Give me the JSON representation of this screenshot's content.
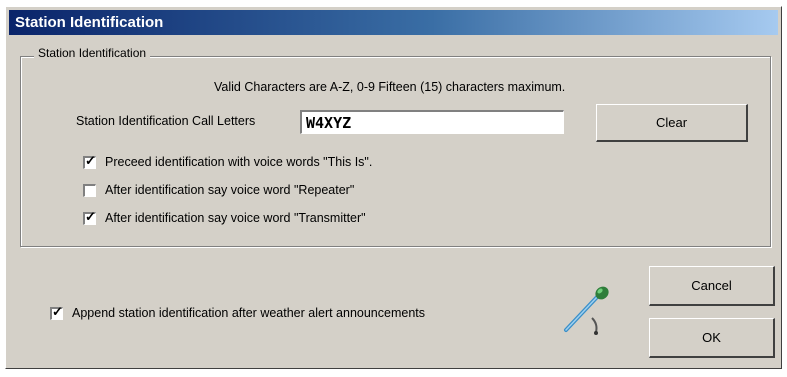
{
  "window": {
    "title": "Station Identification"
  },
  "group": {
    "legend": "Station Identification",
    "valid_chars_text": "Valid Characters are  A-Z,  0-9   Fifteen (15) characters maximum.",
    "call_letters_label": "Station Identification Call Letters",
    "call_letters_value": "W4XYZ",
    "clear_label": "Clear",
    "checkboxes": [
      {
        "label": "Preceed identification with voice words \"This Is\".",
        "checked": true
      },
      {
        "label": "After identification say voice word \"Repeater\"",
        "checked": false
      },
      {
        "label": "After identification say voice word \"Transmitter\"",
        "checked": true
      }
    ]
  },
  "bottom": {
    "append_label": "Append station identification after weather alert announcements",
    "append_checked": true,
    "icon": "microphone-icon",
    "cancel_label": "Cancel",
    "ok_label": "OK"
  }
}
